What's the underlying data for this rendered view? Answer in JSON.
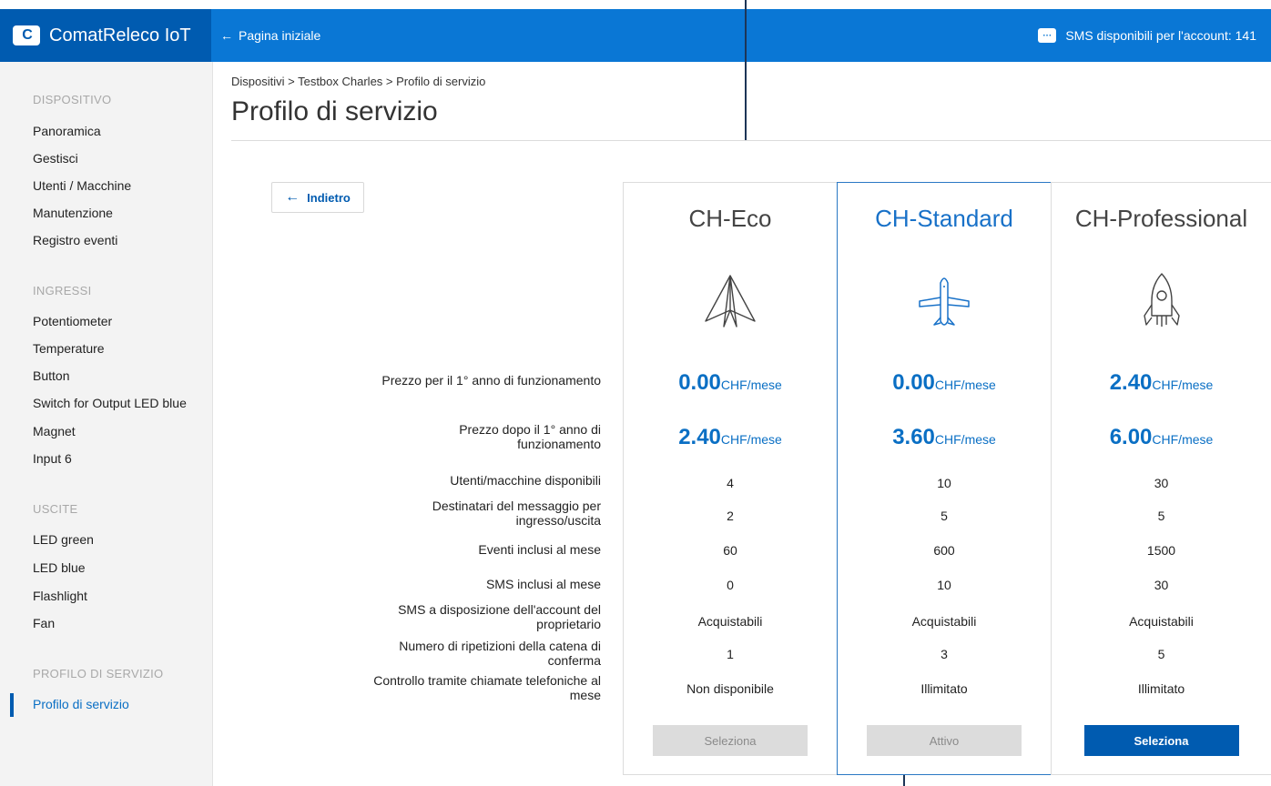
{
  "topbar": {
    "brand": "ComatReleco IoT",
    "home_link": "Pagina iniziale",
    "sms_info": "SMS disponibili per l'account: 141"
  },
  "sidebar": {
    "sections": [
      {
        "title": "DISPOSITIVO",
        "items": [
          "Panoramica",
          "Gestisci",
          "Utenti / Macchine",
          "Manutenzione",
          "Registro eventi"
        ]
      },
      {
        "title": "INGRESSI",
        "items": [
          "Potentiometer",
          "Temperature",
          "Button",
          "Switch for Output LED blue",
          "Magnet",
          "Input 6"
        ]
      },
      {
        "title": "USCITE",
        "items": [
          "LED green",
          "LED blue",
          "Flashlight",
          "Fan"
        ]
      },
      {
        "title": "PROFILO DI SERVIZIO",
        "items": [
          "Profilo di servizio"
        ]
      }
    ],
    "active_item": "Profilo di servizio"
  },
  "main": {
    "breadcrumb": "Dispositivi > Testbox Charles > Profilo di servizio",
    "title": "Profilo di servizio",
    "back_label": "Indietro"
  },
  "row_labels": [
    "Prezzo per il 1° anno di funzionamento",
    "Prezzo dopo il 1° anno di funzionamento",
    "Utenti/macchine disponibili",
    "Destinatari del messaggio per ingresso/uscita",
    "Eventi inclusi al mese",
    "SMS inclusi al mese",
    "SMS a disposizione dell'account del proprietario",
    "Numero di ripetizioni della catena di conferma",
    "Controllo tramite chiamate telefoniche al mese"
  ],
  "price_unit": "CHF/mese",
  "plans": [
    {
      "name": "CH-Eco",
      "icon": "paper-plane-icon",
      "price_first_year": "0.00",
      "price_after": "2.40",
      "users": "4",
      "recipients": "2",
      "events": "60",
      "sms": "0",
      "sms_account": "Acquistabili",
      "repetitions": "1",
      "phone_control": "Non disponibile",
      "button": "Seleziona",
      "button_state": "disabled"
    },
    {
      "name": "CH-Standard",
      "icon": "airplane-icon",
      "price_first_year": "0.00",
      "price_after": "3.60",
      "users": "10",
      "recipients": "5",
      "events": "600",
      "sms": "10",
      "sms_account": "Acquistabili",
      "repetitions": "3",
      "phone_control": "Illimitato",
      "button": "Attivo",
      "button_state": "disabled"
    },
    {
      "name": "CH-Professional",
      "icon": "rocket-icon",
      "price_first_year": "2.40",
      "price_after": "6.00",
      "users": "30",
      "recipients": "5",
      "events": "1500",
      "sms": "30",
      "sms_account": "Acquistabili",
      "repetitions": "5",
      "phone_control": "Illimitato",
      "button": "Seleziona",
      "button_state": "primary"
    }
  ],
  "colors": {
    "topbar": "#0a77d5",
    "brand_bg": "#005bb0",
    "accent": "#0a6fc4",
    "primary_button": "#005bb0"
  }
}
